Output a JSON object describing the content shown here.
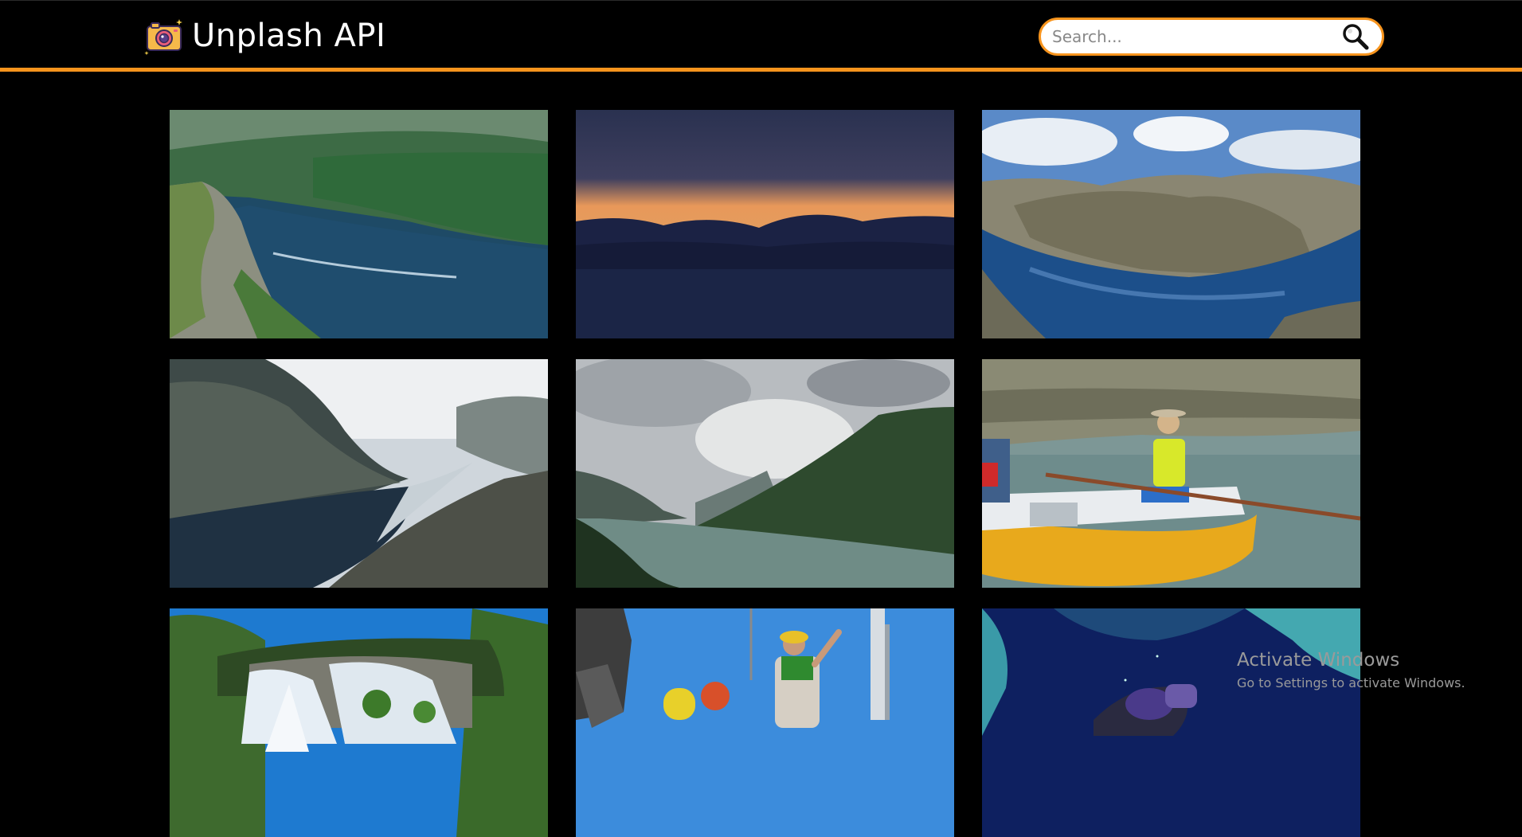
{
  "header": {
    "app_title": "Unplash API",
    "logo_icon": "camera-icon",
    "accent_color": "#f7941d"
  },
  "search": {
    "placeholder": "Search...",
    "value": "",
    "icon": "search-icon"
  },
  "gallery": {
    "photos": [
      {
        "subject": "fjord-cliff-boat"
      },
      {
        "subject": "sunset-mountains-lake"
      },
      {
        "subject": "fjord-blue-sky"
      },
      {
        "subject": "misty-fjord-valley"
      },
      {
        "subject": "cloudy-fjord"
      },
      {
        "subject": "rafting-people"
      },
      {
        "subject": "waterfall"
      },
      {
        "subject": "worker-on-ship"
      },
      {
        "subject": "underwater-diver"
      }
    ]
  },
  "watermark": {
    "line1": "Activate Windows",
    "line2": "Go to Settings to activate Windows."
  }
}
